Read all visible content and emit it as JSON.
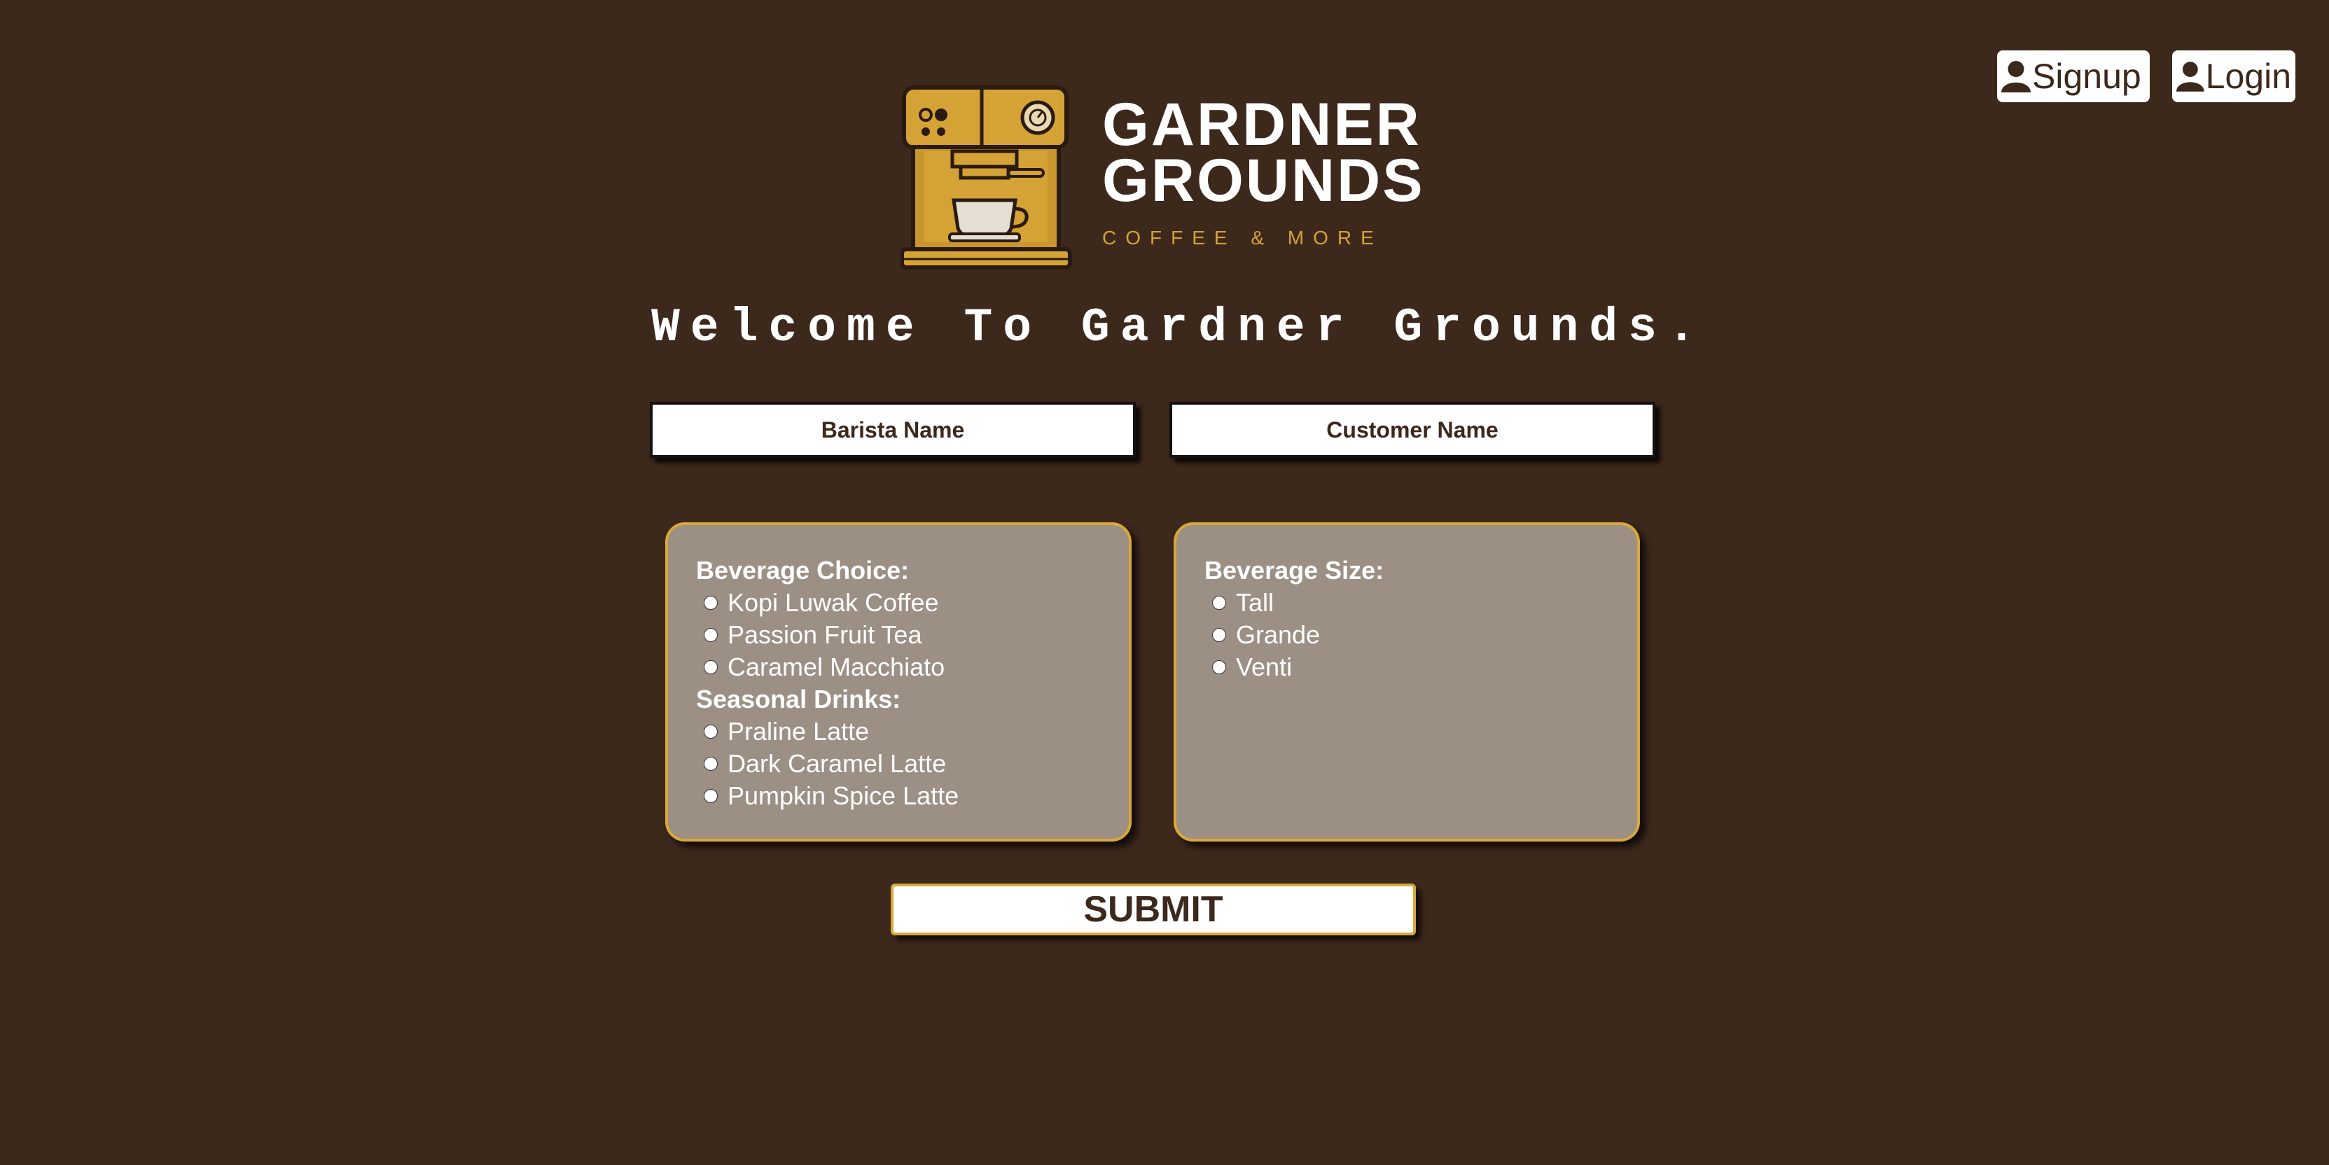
{
  "header": {
    "signup_label": "Signup",
    "login_label": "Login"
  },
  "brand": {
    "line1": "GARDNER",
    "line2": "GROUNDS",
    "tagline": "COFFEE & MORE"
  },
  "welcome": "Welcome To Gardner Grounds.",
  "inputs": {
    "barista_placeholder": "Barista Name",
    "customer_placeholder": "Customer Name"
  },
  "beverage_choice": {
    "title": "Beverage Choice:",
    "options": [
      "Kopi Luwak Coffee",
      "Passion Fruit Tea",
      "Caramel Macchiato"
    ],
    "seasonal_title": "Seasonal Drinks:",
    "seasonal_options": [
      "Praline Latte",
      "Dark Caramel Latte",
      "Pumpkin Spice Latte"
    ]
  },
  "beverage_size": {
    "title": "Beverage Size:",
    "options": [
      "Tall",
      "Grande",
      "Venti"
    ]
  },
  "submit_label": "SUBMIT",
  "colors": {
    "background": "#3d281c",
    "accent_gold": "#d8a839",
    "card": "#9c8f84"
  },
  "icons": [
    "user-icon",
    "coffee-machine-logo"
  ]
}
